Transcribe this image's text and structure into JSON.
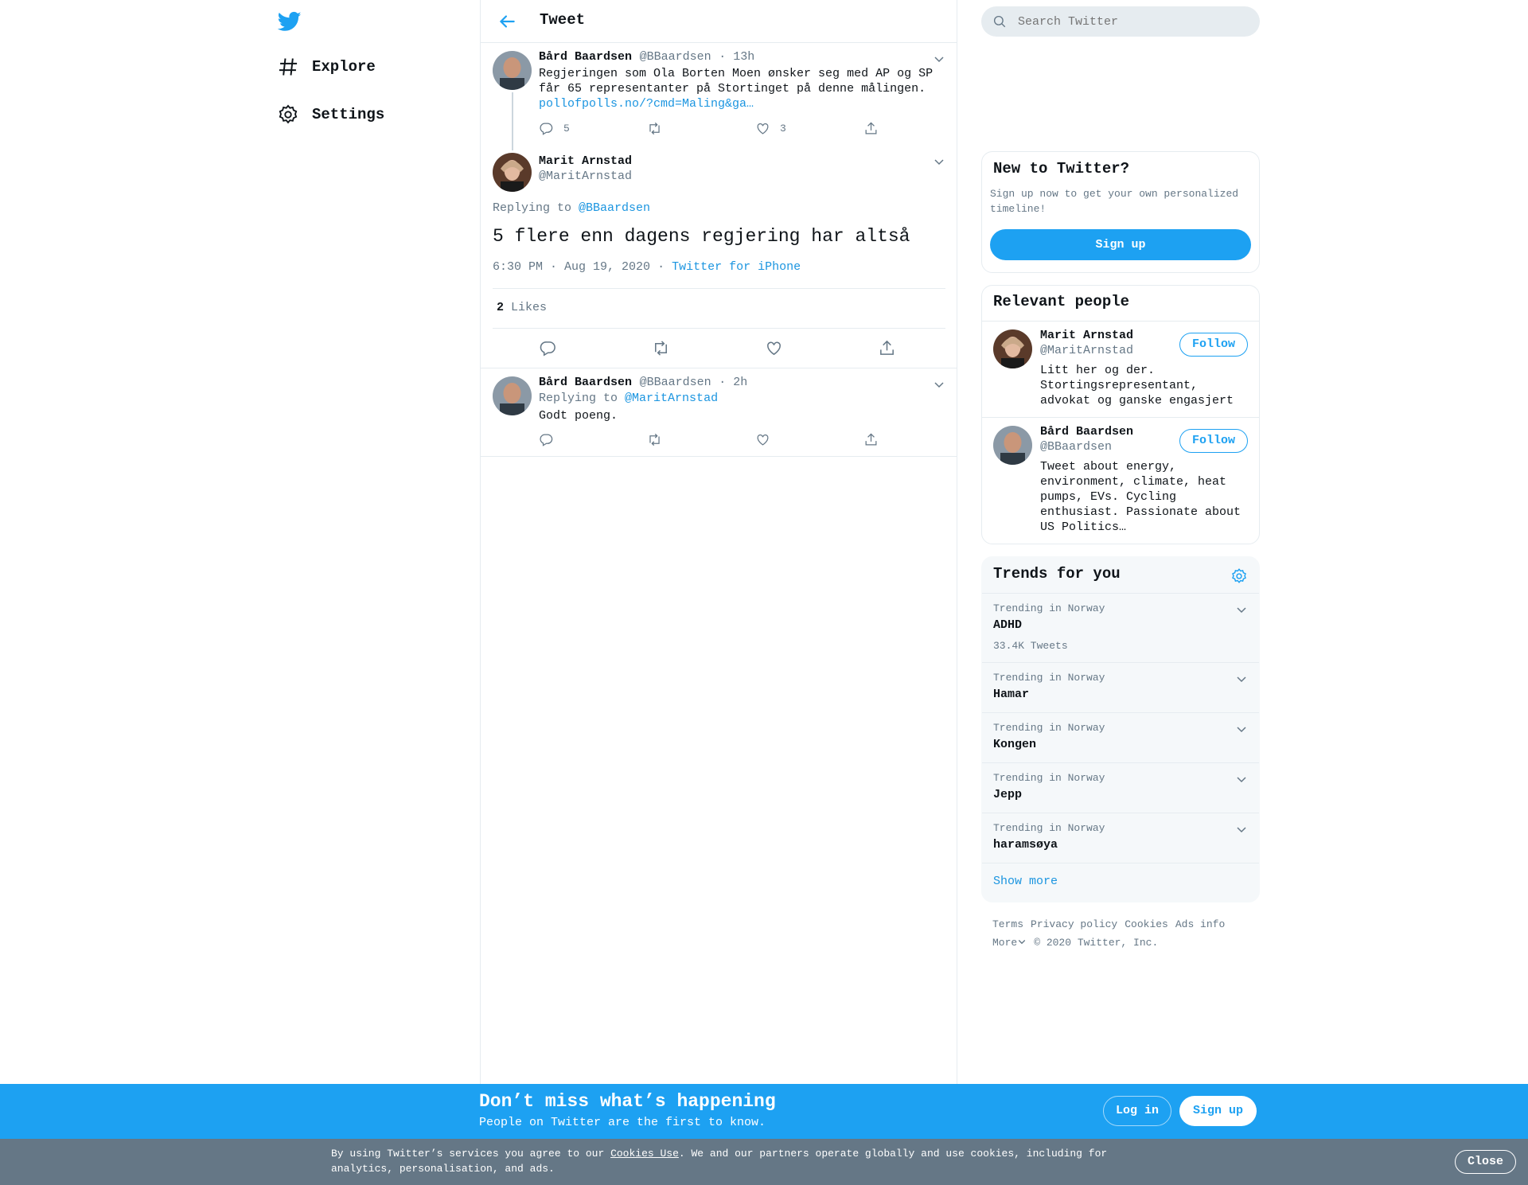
{
  "nav": {
    "items": [
      {
        "label": "Explore",
        "icon": "hashtag-icon"
      },
      {
        "label": "Settings",
        "icon": "gear-icon"
      }
    ]
  },
  "header": {
    "title": "Tweet"
  },
  "parent_tweet": {
    "name": "Bård Baardsen",
    "handle": "@BBaardsen",
    "time": "· 13h",
    "text": "Regjeringen som Ola Borten Moen ønsker seg med AP og SP får 65 representanter på Stortinget på denne målingen.",
    "link": "pollofpolls.no/?cmd=Maling&ga…",
    "replies": "5",
    "likes": "3"
  },
  "main_tweet": {
    "name": "Marit Arnstad",
    "handle": "@MaritArnstad",
    "replying_label": "Replying to",
    "replying_to": "@BBaardsen",
    "text": "5 flere enn dagens regjering har altså",
    "timestamp": "6:30 PM · Aug 19, 2020",
    "dot": "·",
    "source": "Twitter for iPhone",
    "likes_count": "2",
    "likes_label": "Likes"
  },
  "reply_tweet": {
    "name": "Bård Baardsen",
    "handle": "@BBaardsen",
    "time": "· 2h",
    "replying_label": "Replying to",
    "replying_to": "@MaritArnstad",
    "text": "Godt poeng."
  },
  "search": {
    "placeholder": "Search Twitter"
  },
  "new_to_twitter": {
    "title": "New to Twitter?",
    "text": "Sign up now to get your own personalized timeline!",
    "button": "Sign up"
  },
  "relevant_people": {
    "title": "Relevant people",
    "people": [
      {
        "name": "Marit Arnstad",
        "handle": "@MaritArnstad",
        "bio": "Litt her og der. Stortingsrepresentant, advokat og ganske engasjert",
        "follow": "Follow"
      },
      {
        "name": "Bård Baardsen",
        "handle": "@BBaardsen",
        "bio": "Tweet about energy, environment, climate, heat pumps, EVs. Cycling enthusiast. Passionate about US Politics…",
        "follow": "Follow"
      }
    ]
  },
  "trends": {
    "title": "Trends for you",
    "items": [
      {
        "context": "Trending in Norway",
        "name": "ADHD",
        "count": "33.4K Tweets"
      },
      {
        "context": "Trending in Norway",
        "name": "Hamar"
      },
      {
        "context": "Trending in Norway",
        "name": "Kongen"
      },
      {
        "context": "Trending in Norway",
        "name": "Jepp"
      },
      {
        "context": "Trending in Norway",
        "name": "haramsøya"
      }
    ],
    "show_more": "Show more"
  },
  "footer": {
    "links": [
      "Terms",
      "Privacy policy",
      "Cookies",
      "Ads info"
    ],
    "more": "More",
    "copyright": "© 2020 Twitter, Inc."
  },
  "bottom_bar": {
    "title": "Don’t miss what’s happening",
    "subtitle": "People on Twitter are the first to know.",
    "login": "Log in",
    "signup": "Sign up"
  },
  "cookie_banner": {
    "text_before": "By using Twitter’s services you agree to our ",
    "link": "Cookies Use",
    "text_after": ". We and our partners operate globally and use cookies, including for analytics, personalisation, and ads.",
    "close": "Close"
  },
  "colors": {
    "accent": "#1da1f2",
    "link": "#1b95e0",
    "muted": "#657786",
    "border": "#e6ecf0",
    "cookie_bg": "#657786"
  }
}
